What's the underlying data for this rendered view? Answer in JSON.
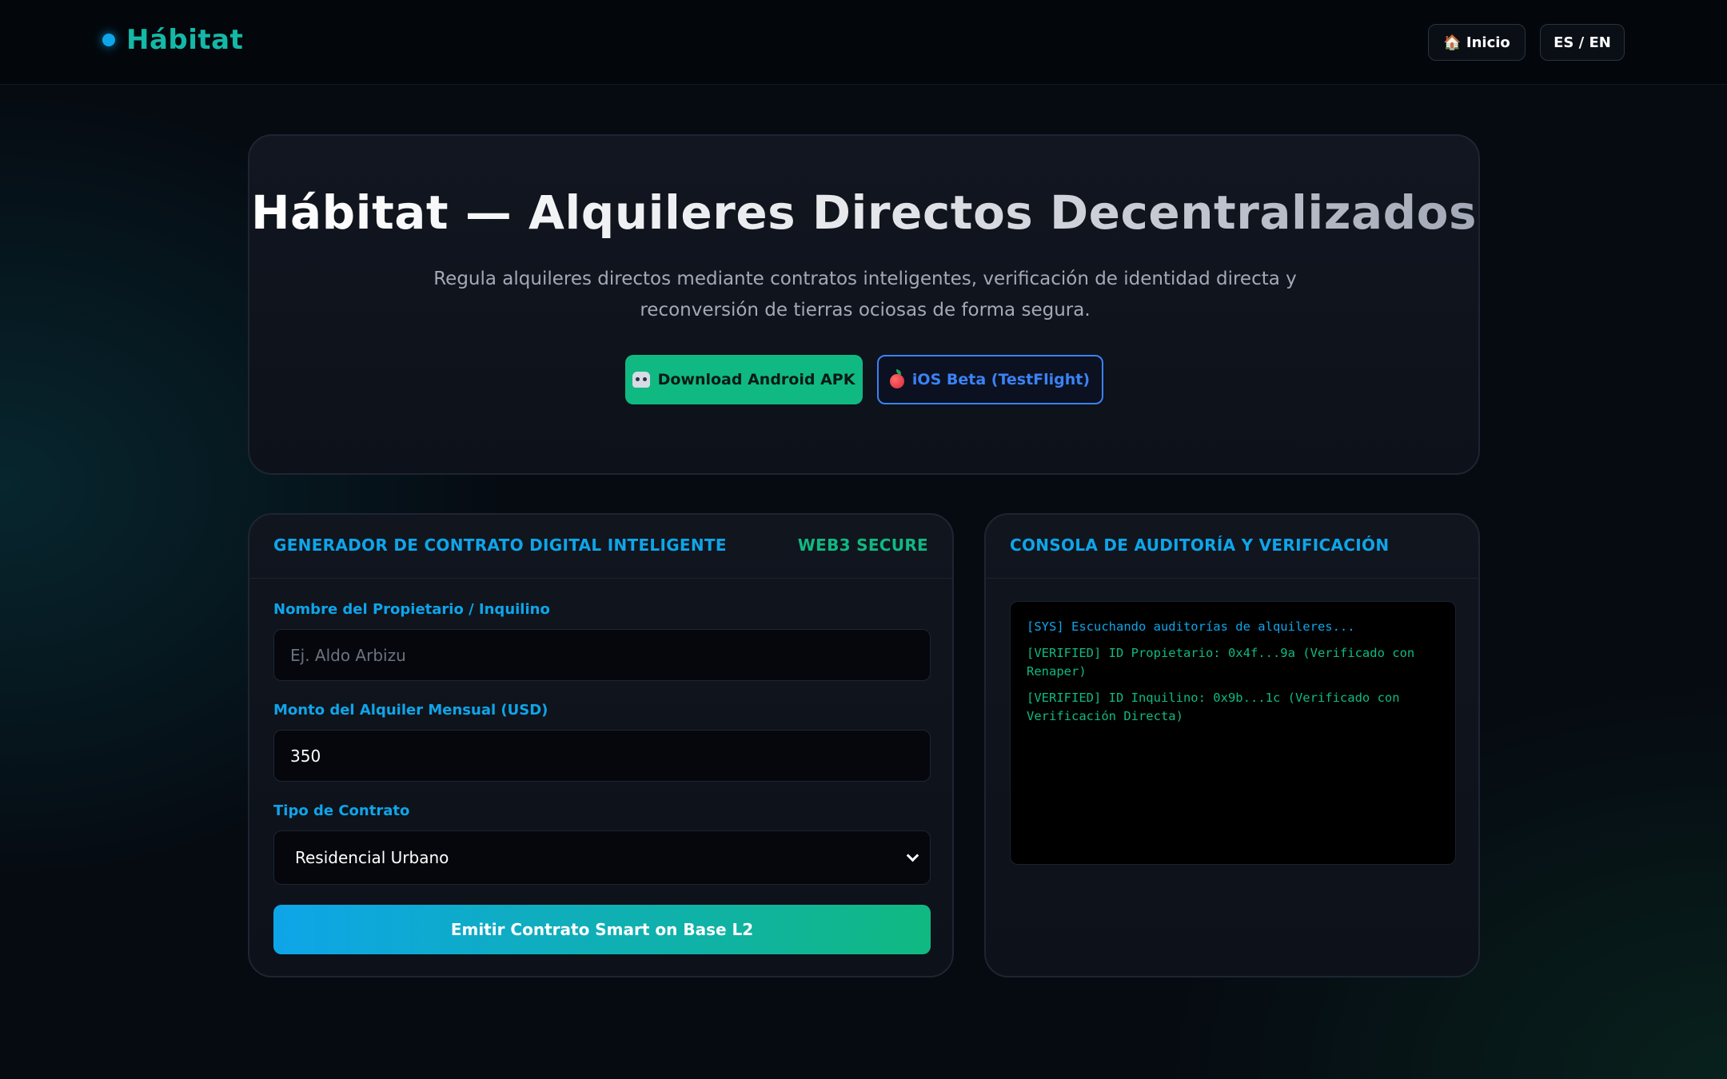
{
  "brand": {
    "name": "Hábitat",
    "accent": "#14b8a6",
    "dot_color": "#0ea5e9"
  },
  "nav": {
    "home_icon": "house-icon",
    "home_label": "🏠 Inicio",
    "lang_label": "ES / EN"
  },
  "hero": {
    "title": "Hábitat — Alquileres Directos Decentralizados",
    "subtitle": "Regula alquileres directos mediante contratos inteligentes, verificación de identidad directa y reconversión de tierras ociosas de forma segura.",
    "android_button": {
      "icon": "robot-icon",
      "label": "Download Android APK",
      "color": "#10b981"
    },
    "ios_button": {
      "icon": "apple-icon",
      "label": "iOS Beta (TestFlight)",
      "color": "#3b82f6"
    }
  },
  "contract_form": {
    "title": "GENERADOR DE CONTRATO DIGITAL INTELIGENTE",
    "badge": "WEB3 SECURE",
    "owner_label": "Nombre del Propietario / Inquilino",
    "owner_placeholder": "Ej. Aldo Arbizu",
    "owner_value": "",
    "amount_label": "Monto del Alquiler Mensual (USD)",
    "amount_value": "350",
    "type_label": "Tipo de Contrato",
    "type_selected": "Residencial Urbano",
    "submit_label": "Emitir Contrato Smart on Base L2"
  },
  "audit_console": {
    "title": "CONSOLA DE AUDITORÍA Y VERIFICACIÓN",
    "logs": [
      {
        "level": "sys",
        "text": "[SYS] Escuchando auditorías de alquileres..."
      },
      {
        "level": "verified",
        "text": "[VERIFIED] ID Propietario: 0x4f...9a (Verificado con Renaper)"
      },
      {
        "level": "verified",
        "text": "[VERIFIED] ID Inquilino: 0x9b...1c (Verificado con Verificación Directa)"
      }
    ]
  }
}
